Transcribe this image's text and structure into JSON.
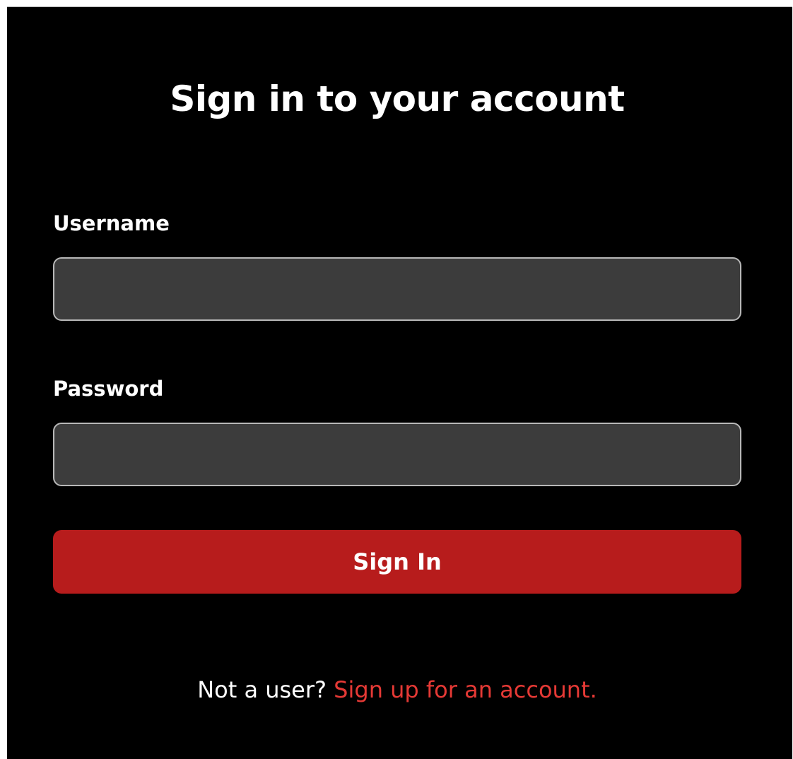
{
  "form": {
    "title": "Sign in to your account",
    "username_label": "Username",
    "username_value": "",
    "password_label": "Password",
    "password_value": "",
    "submit_label": "Sign In"
  },
  "footer": {
    "prompt": "Not a user?",
    "link_text": "Sign up for an account."
  },
  "colors": {
    "background": "#000000",
    "field_background": "#3c3c3c",
    "field_border": "#b8b8b8",
    "accent": "#b71c1c",
    "link": "#e53935"
  }
}
